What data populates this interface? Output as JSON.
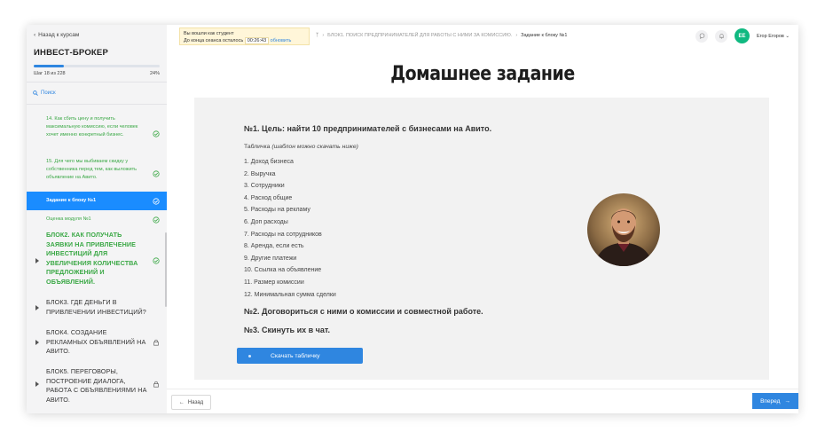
{
  "sidebar": {
    "back_label": "Назад к курсам",
    "course_title": "ИНВЕСТ-БРОКЕР",
    "progress_percent": 24,
    "step_text": "Шаг 18 из 228",
    "step_pct": "24%",
    "search_label": "Поиск",
    "items": [
      {
        "label": "14. Как сбить цену и получить максимальную комиссию, если человек хочет именно конкретный бизнес.",
        "status": "done"
      },
      {
        "label": "15. Для чего мы выбиваем скидку у собственника перед тем, как выложить объявление на Авито.",
        "status": "done"
      },
      {
        "label": "Задание к блоку №1",
        "status": "active"
      },
      {
        "label": "Оценка модуля №1",
        "status": "done"
      },
      {
        "label": "БЛОК2. КАК ПОЛУЧАТЬ ЗАЯВКИ НА ПРИВЛЕЧЕНИЕ ИНВЕСТИЦИЙ ДЛЯ УВЕЛИЧЕНИЯ КОЛИЧЕСТВА ПРЕДЛОЖЕНИЙ И ОБЪЯВЛЕНИЙ.",
        "status": "done"
      },
      {
        "label": "БЛОК3. ГДЕ ДЕНЬГИ В ПРИВЛЕЧЕНИИ ИНВЕСТИЦИЙ?",
        "status": "open"
      },
      {
        "label": "БЛОК4. СОЗДАНИЕ РЕКЛАМНЫХ ОБЪЯВЛЕНИЙ НА АВИТО.",
        "status": "locked"
      },
      {
        "label": "БЛОК5. ПЕРЕГОВОРЫ, ПОСТРОЕНИЕ ДИАЛОГА, РАБОТА С ОБЪЯВЛЕНИЯМИ НА АВИТО.",
        "status": "locked"
      }
    ]
  },
  "topbar": {
    "student_line1": "Вы вошли как студент",
    "student_line2": "До конца сеанса осталось",
    "timer": "00:26:43",
    "refresh_label": "обновить",
    "breadcrumb_module": "БЛОК1. ПОИСК ПРЕДПРИНИМАТЕЛЕЙ ДЛЯ РАБОТЫ С НИМИ ЗА КОМИССИЮ.",
    "breadcrumb_current": "Задание к блоку №1",
    "avatar_initials": "ЕЕ",
    "user_name": "Егор Егоров"
  },
  "main": {
    "title": "Домашнее задание",
    "task1": "№1. Цель: найти 10 предпринимателей с бизнесами на Авито.",
    "intro_prefix": "Табличка ",
    "intro_italic": "(шаблон можно скачать ниже)",
    "list": [
      "1. Доход бизнеса",
      "2. Выручка",
      "3. Сотрудники",
      "4. Расход общие",
      "5. Расходы на рекламу",
      "6. Доп расходы",
      "7. Расходы на сотрудников",
      "8. Аренда, если есть",
      "9. Другие платежи",
      "10. Ссылка на объявление",
      "11. Размер комиссии",
      "12. Минимальная сумма сделки"
    ],
    "task2": "№2. Договориться с ними о комиссии и совместной работе.",
    "task3": "№3. Скинуть их в чат.",
    "download_label": "Скачать табличку"
  },
  "nav": {
    "prev_label": "Назад",
    "next_label": "Вперед"
  },
  "colors": {
    "accent": "#2f86e0",
    "active_item": "#1a8cff",
    "done_green": "#3aa845",
    "avatar_green": "#10b981",
    "session_bg": "#fff6d9"
  }
}
